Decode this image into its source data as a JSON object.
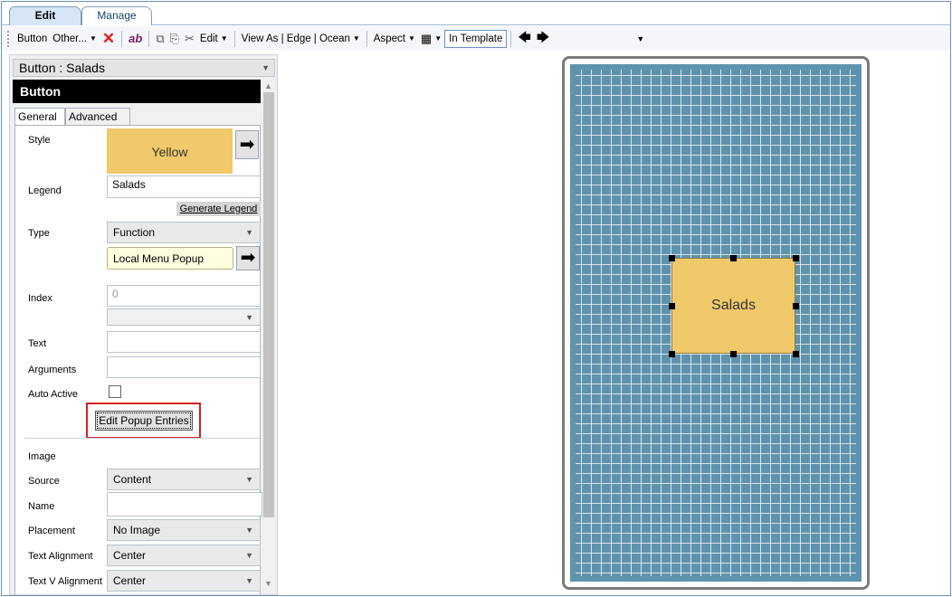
{
  "tabs": {
    "edit": "Edit",
    "manage": "Manage"
  },
  "toolbar": {
    "button": "Button",
    "other": "Other...",
    "ab": "ab",
    "edit": "Edit",
    "view_as": "View As | Edge | Ocean",
    "aspect": "Aspect",
    "in_template": "In Template"
  },
  "panel": {
    "object_combo": "Button : Salads",
    "header": "Button",
    "tab_general": "General",
    "tab_advanced": "Advanced",
    "style_label": "Style",
    "style_value": "Yellow",
    "legend_label": "Legend",
    "legend_value": "Salads",
    "generate_legend": "Generate Legend",
    "type_label": "Type",
    "type_value": "Function",
    "function_value": "Local Menu Popup",
    "index_label": "Index",
    "index_value": "0",
    "text_label": "Text",
    "arguments_label": "Arguments",
    "auto_active_label": "Auto Active",
    "edit_popup_entries": "Edit Popup Entries",
    "image_label": "Image",
    "source_label": "Source",
    "source_value": "Content",
    "name_label": "Name",
    "placement_label": "Placement",
    "placement_value": "No Image",
    "text_alignment_label": "Text Alignment",
    "text_alignment_value": "Center",
    "text_v_alignment_label": "Text V Alignment",
    "text_v_alignment_value": "Center"
  },
  "canvas": {
    "button_label": "Salads"
  },
  "colors": {
    "button_yellow": "#f0c96a",
    "grid_blue": "#5f93ad",
    "highlight_red": "#d42020"
  }
}
